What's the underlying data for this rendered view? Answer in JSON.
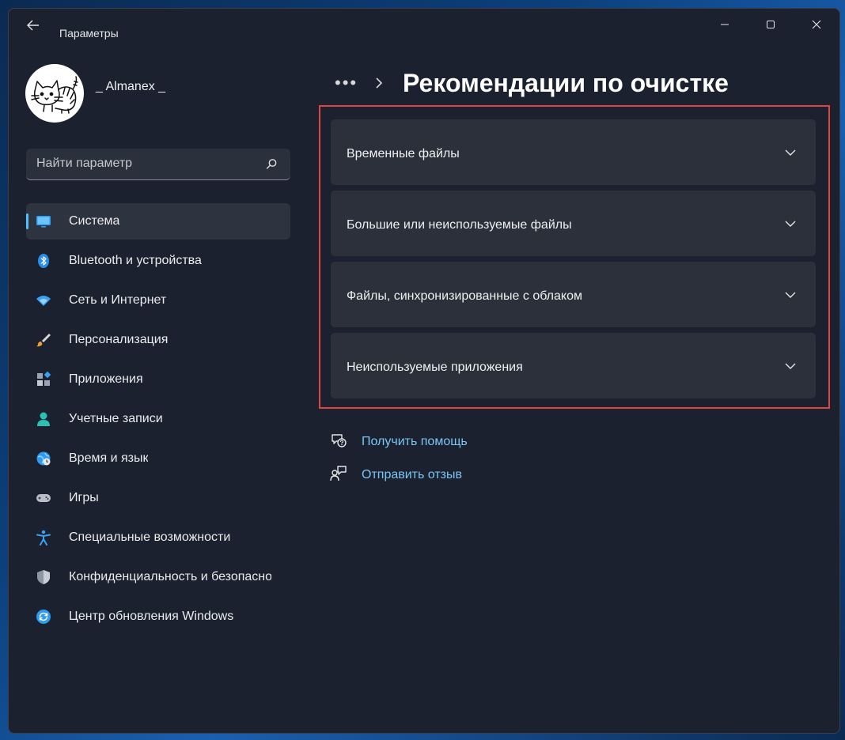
{
  "window": {
    "title": "Параметры"
  },
  "profile": {
    "name": "_ Almanex _"
  },
  "search": {
    "placeholder": "Найти параметр"
  },
  "sidebar": {
    "items": [
      {
        "label": "Система",
        "icon": "monitor-icon",
        "active": true
      },
      {
        "label": "Bluetooth и устройства",
        "icon": "bluetooth-icon"
      },
      {
        "label": "Сеть и Интернет",
        "icon": "wifi-icon"
      },
      {
        "label": "Персонализация",
        "icon": "brush-icon"
      },
      {
        "label": "Приложения",
        "icon": "apps-icon"
      },
      {
        "label": "Учетные записи",
        "icon": "person-icon"
      },
      {
        "label": "Время и язык",
        "icon": "globe-clock-icon"
      },
      {
        "label": "Игры",
        "icon": "gamepad-icon"
      },
      {
        "label": "Специальные возможности",
        "icon": "accessibility-icon"
      },
      {
        "label": "Конфиденциальность и безопасность",
        "icon": "shield-icon"
      },
      {
        "label": "Центр обновления Windows",
        "icon": "update-icon"
      }
    ]
  },
  "breadcrumb": {
    "more": "•••",
    "title": "Рекомендации по очистке"
  },
  "sections": [
    {
      "label": "Временные файлы"
    },
    {
      "label": "Большие или неиспользуемые файлы"
    },
    {
      "label": "Файлы, синхронизированные с облаком"
    },
    {
      "label": "Неиспользуемые приложения"
    }
  ],
  "links": {
    "help": "Получить помощь",
    "feedback": "Отправить отзыв"
  },
  "colors": {
    "accent": "#4cc2ff",
    "link": "#79c6f5",
    "highlight": "#e0443e"
  }
}
